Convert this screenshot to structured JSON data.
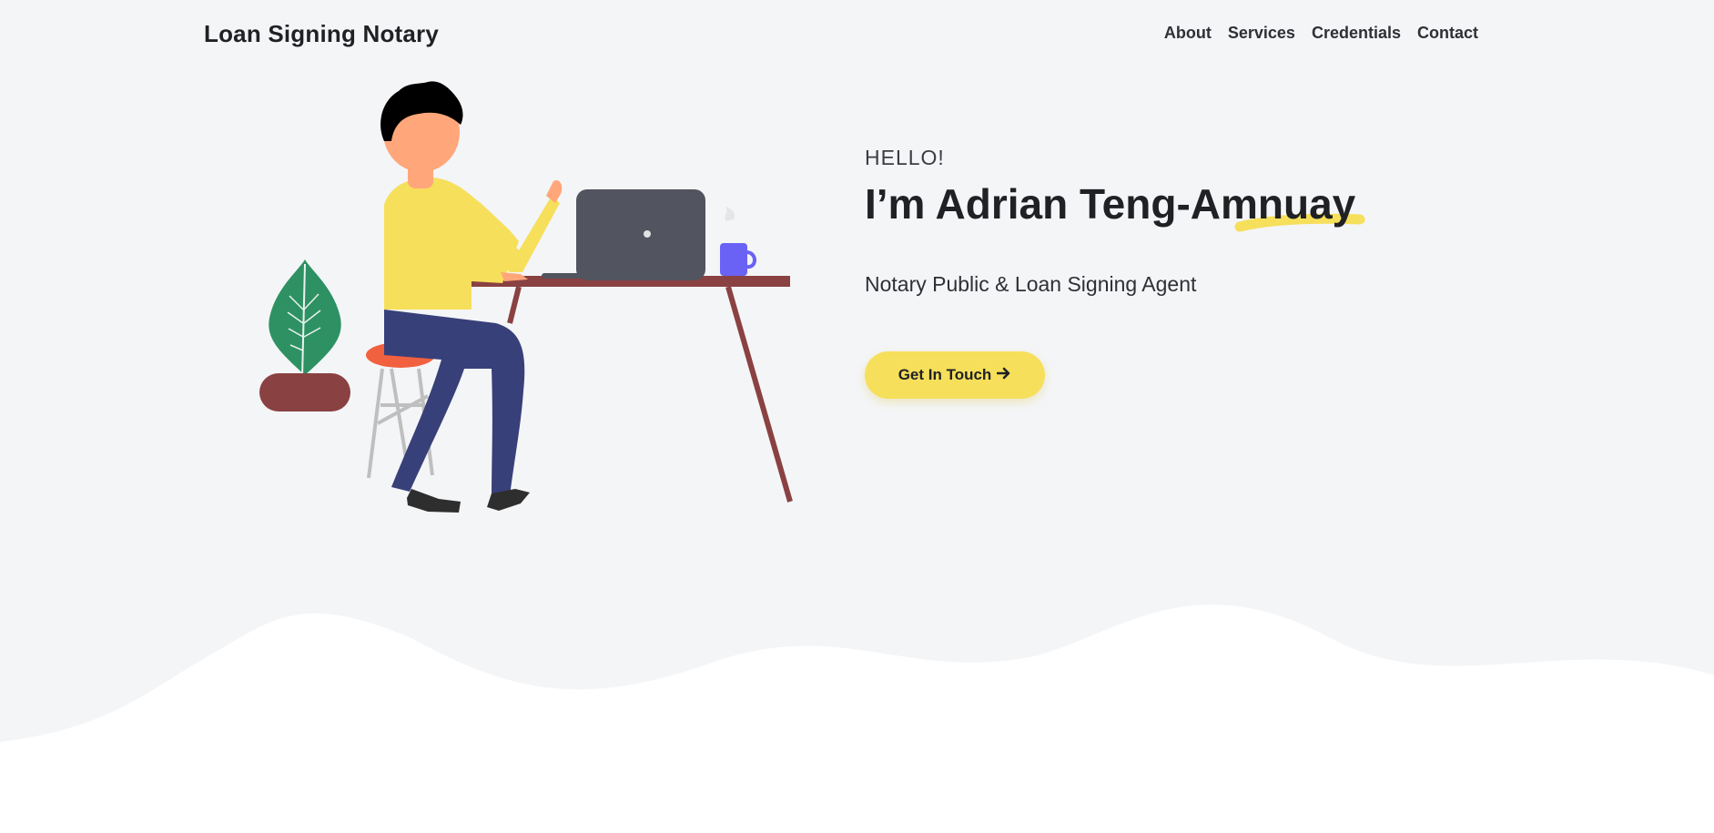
{
  "header": {
    "brand": "Loan Signing Notary",
    "nav": [
      {
        "label": "About"
      },
      {
        "label": "Services"
      },
      {
        "label": "Credentials"
      },
      {
        "label": "Contact"
      }
    ]
  },
  "hero": {
    "greeting": "HELLO!",
    "headline": "I’m Adrian Teng-Amnuay",
    "subtitle": "Notary Public & Loan Signing Agent",
    "cta_label": "Get In Touch",
    "cta_icon": "arrow-right-icon"
  },
  "colors": {
    "background": "#f4f5f7",
    "accent_yellow": "#f6df5b",
    "text_dark": "#1f2125",
    "wave_white": "#ffffff"
  }
}
